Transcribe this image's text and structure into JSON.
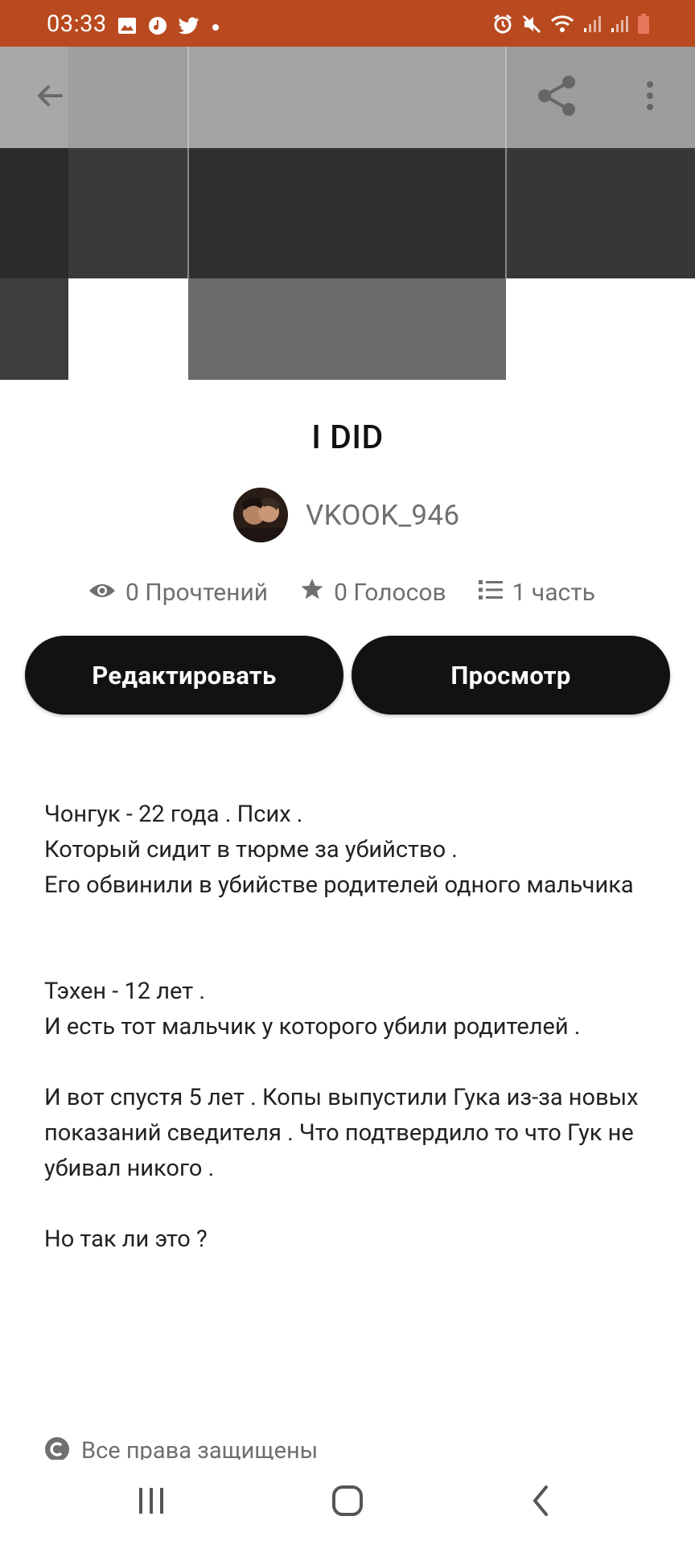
{
  "status_bar": {
    "time": "03:33",
    "left_icons": [
      "image-icon",
      "music-icon",
      "twitter-icon",
      "dot-icon"
    ],
    "right_icons": [
      "alarm-icon",
      "mute-icon",
      "wifi-icon",
      "signal-icon",
      "signal-icon",
      "battery-low-icon"
    ],
    "color": "#b94a1f"
  },
  "toolbar": {
    "back_icon": "arrow-left-icon",
    "share_icon": "share-icon",
    "more_icon": "more-vertical-icon"
  },
  "story": {
    "title": "I DID",
    "author": "VKOOK_946",
    "stats": {
      "reads": "0 Прочтений",
      "votes": "0 Голосов",
      "parts": "1 часть"
    },
    "buttons": {
      "edit": "Редактировать",
      "view": "Просмотр"
    },
    "description": {
      "p1": [
        "Чонгук - 22  года . Псих .",
        "Который сидит в тюрме за убийство .",
        "Его обвинили в убийстве родителей одного мальчика"
      ],
      "p2": [
        "Тэхен - 12 лет .",
        "И есть тот мальчик у которого убили родителей ."
      ],
      "p3": [
        "И вот спустя 5 лет . Копы выпустили Гука из-за новых показаний сведителя . Что подтвердило то что Гук не убивал никого ."
      ],
      "p4": [
        "Но так ли это ?"
      ]
    },
    "copyright": "Все права защищены"
  },
  "nav_bar": {
    "recent_icon": "recent-apps-icon",
    "home_icon": "home-icon",
    "back_icon": "back-chevron-icon"
  }
}
